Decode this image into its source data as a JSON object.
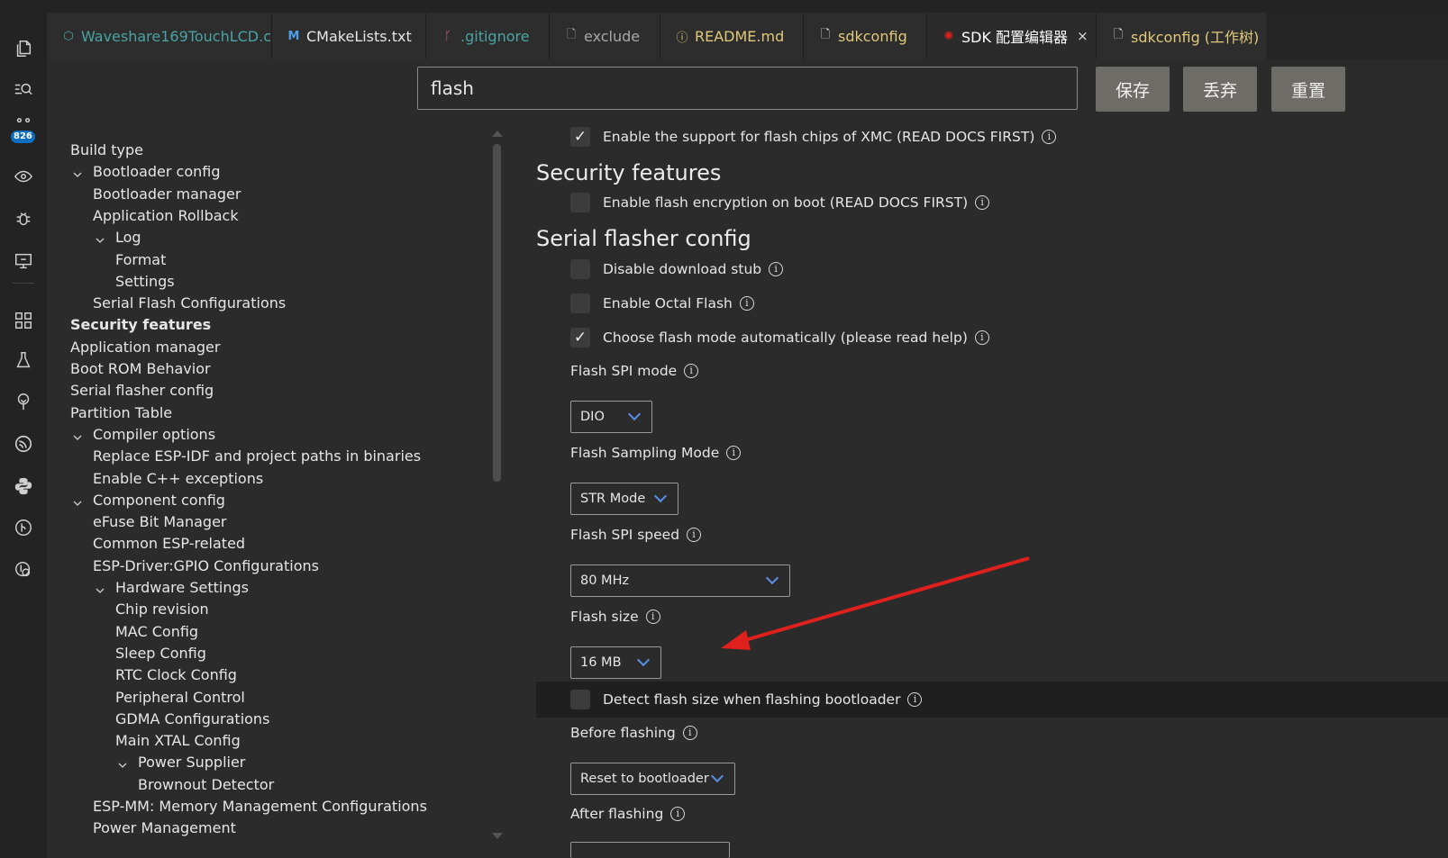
{
  "tabs": [
    {
      "label": "Waveshare169TouchLCD.c",
      "icon": "c-file-icon",
      "color": "#4aa3a3"
    },
    {
      "label": "CMakeLists.txt",
      "icon": "cmake-m-icon",
      "color": "#e6e6e6"
    },
    {
      "label": ".gitignore",
      "icon": "git-icon",
      "color": "#4aa3a3"
    },
    {
      "label": "exclude",
      "icon": "file-icon",
      "color": "#a8a8a8"
    },
    {
      "label": "README.md",
      "icon": "info-icon",
      "color": "#e0c97a"
    },
    {
      "label": "sdkconfig",
      "icon": "file-icon",
      "color": "#e0c97a"
    },
    {
      "label": "SDK 配置编辑器",
      "icon": "espressif-icon",
      "color": "#ffffff",
      "close": "×"
    },
    {
      "label": "sdkconfig (工作树)",
      "icon": "file-icon",
      "color": "#e0c97a"
    }
  ],
  "activity": {
    "badge": "826"
  },
  "search": {
    "value": "flash"
  },
  "buttons": {
    "save": "保存",
    "discard": "丢弃",
    "reset": "重置"
  },
  "tree": [
    {
      "label": "Build type",
      "indent": 0
    },
    {
      "label": "Bootloader config",
      "indent": 1,
      "expanded": true
    },
    {
      "label": "Bootloader manager",
      "indent": 1
    },
    {
      "label": "Application Rollback",
      "indent": 1
    },
    {
      "label": "Log",
      "indent": 2,
      "expanded": true
    },
    {
      "label": "Format",
      "indent": 2
    },
    {
      "label": "Settings",
      "indent": 2
    },
    {
      "label": "Serial Flash Configurations",
      "indent": 1
    },
    {
      "label": "Security features",
      "indent": 0,
      "bold": true
    },
    {
      "label": "Application manager",
      "indent": 0
    },
    {
      "label": "Boot ROM Behavior",
      "indent": 0
    },
    {
      "label": "Serial flasher config",
      "indent": 0
    },
    {
      "label": "Partition Table",
      "indent": 0
    },
    {
      "label": "Compiler options",
      "indent": 1,
      "expanded": true
    },
    {
      "label": "Replace ESP-IDF and project paths in binaries",
      "indent": 1
    },
    {
      "label": "Enable C++ exceptions",
      "indent": 1
    },
    {
      "label": "Component config",
      "indent": 1,
      "expanded": true
    },
    {
      "label": "eFuse Bit Manager",
      "indent": 1
    },
    {
      "label": "Common ESP-related",
      "indent": 1
    },
    {
      "label": "ESP-Driver:GPIO Configurations",
      "indent": 1
    },
    {
      "label": "Hardware Settings",
      "indent": 2,
      "expanded": true
    },
    {
      "label": "Chip revision",
      "indent": 2
    },
    {
      "label": "MAC Config",
      "indent": 2
    },
    {
      "label": "Sleep Config",
      "indent": 2
    },
    {
      "label": "RTC Clock Config",
      "indent": 2
    },
    {
      "label": "Peripheral Control",
      "indent": 2
    },
    {
      "label": "GDMA Configurations",
      "indent": 2
    },
    {
      "label": "Main XTAL Config",
      "indent": 2
    },
    {
      "label": "Power Supplier",
      "indent": 3,
      "expanded": true
    },
    {
      "label": "Brownout Detector",
      "indent": 3
    },
    {
      "label": "ESP-MM: Memory Management Configurations",
      "indent": 1
    },
    {
      "label": "Power Management",
      "indent": 1
    }
  ],
  "settings": {
    "xmc": {
      "label": "Enable the support for flash chips of XMC (READ DOCS FIRST)",
      "checked": true
    },
    "security_heading": "Security features",
    "flash_encryption": {
      "label": "Enable flash encryption on boot (READ DOCS FIRST)",
      "checked": false
    },
    "serial_heading": "Serial flasher config",
    "disable_stub": {
      "label": "Disable download stub",
      "checked": false
    },
    "octal_flash": {
      "label": "Enable Octal Flash",
      "checked": false
    },
    "auto_mode": {
      "label": "Choose flash mode automatically (please read help)",
      "checked": true
    },
    "spi_mode": {
      "label": "Flash SPI mode",
      "value": "DIO"
    },
    "sampling_mode": {
      "label": "Flash Sampling Mode",
      "value": "STR Mode"
    },
    "spi_speed": {
      "label": "Flash SPI speed",
      "value": "80 MHz"
    },
    "flash_size": {
      "label": "Flash size",
      "value": "16 MB"
    },
    "detect_size": {
      "label": "Detect flash size when flashing bootloader",
      "checked": false
    },
    "before_flashing": {
      "label": "Before flashing",
      "value": "Reset to bootloader"
    },
    "after_flashing": {
      "label": "After flashing"
    }
  },
  "annotation_color": "#e0201c"
}
